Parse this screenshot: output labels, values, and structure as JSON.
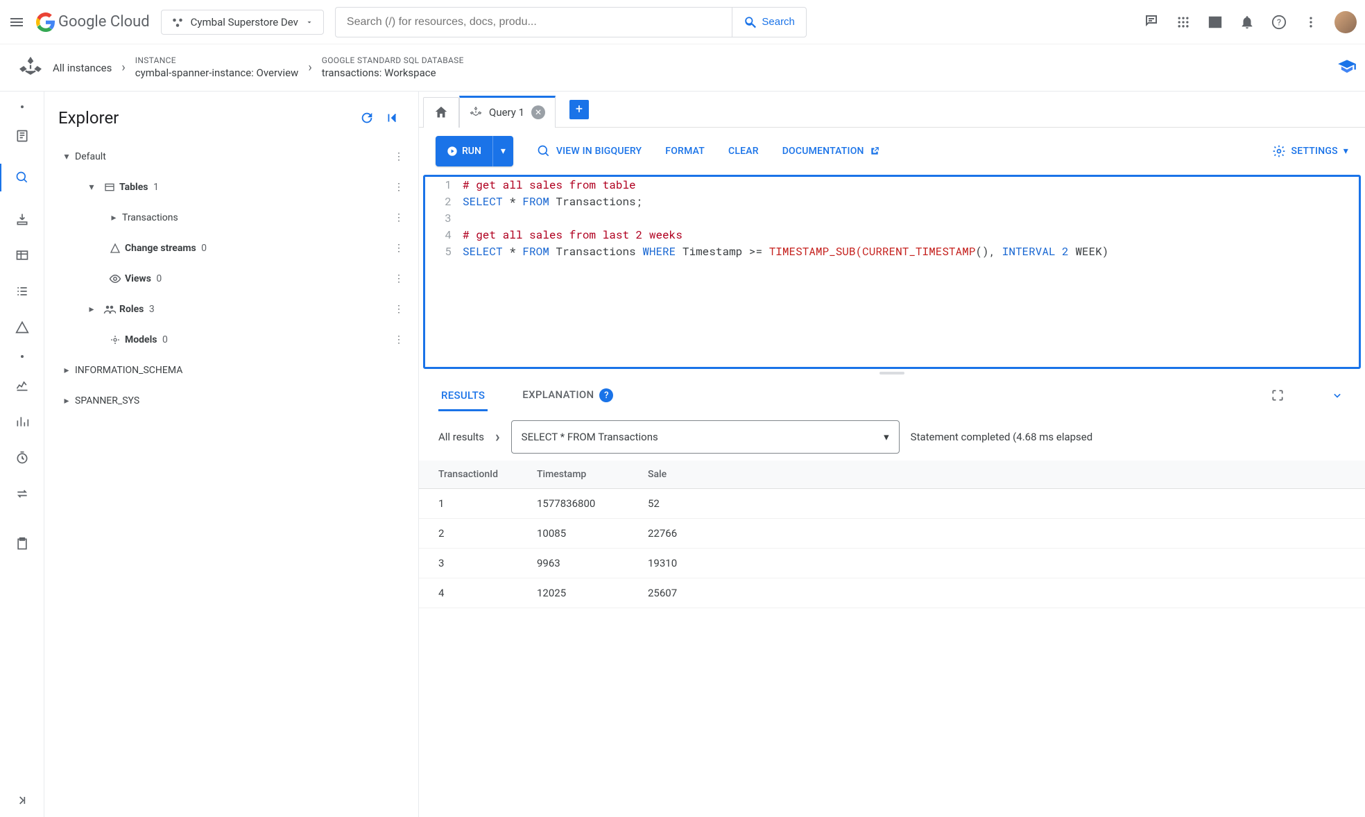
{
  "header": {
    "logo_text": "Google Cloud",
    "project": "Cymbal Superstore Dev",
    "search_placeholder": "Search (/) for resources, docs, produ...",
    "search_btn": "Search"
  },
  "breadcrumb": {
    "root": "All instances",
    "instance_label": "INSTANCE",
    "instance_value": "cymbal-spanner-instance: Overview",
    "db_label": "GOOGLE STANDARD SQL DATABASE",
    "db_value": "transactions: Workspace"
  },
  "explorer": {
    "title": "Explorer",
    "tree": {
      "default": "Default",
      "tables": "Tables",
      "tables_count": "1",
      "transactions": "Transactions",
      "change_streams": "Change streams",
      "change_streams_count": "0",
      "views": "Views",
      "views_count": "0",
      "roles": "Roles",
      "roles_count": "3",
      "models": "Models",
      "models_count": "0",
      "info_schema": "INFORMATION_SCHEMA",
      "spanner_sys": "SPANNER_SYS"
    }
  },
  "workspace": {
    "tab_label": "Query 1",
    "toolbar": {
      "run": "RUN",
      "view_bq": "VIEW IN BIGQUERY",
      "format": "FORMAT",
      "clear": "CLEAR",
      "documentation": "DOCUMENTATION",
      "settings": "SETTINGS"
    },
    "code": {
      "l1_comment": "# get all sales from table",
      "l2_kw1": "SELECT",
      "l2_mid": " * ",
      "l2_kw2": "FROM",
      "l2_tail": " Transactions;",
      "l4_comment": "# get all sales from last 2 weeks",
      "l5_kw1": "SELECT",
      "l5_mid1": " * ",
      "l5_kw2": "FROM",
      "l5_mid2": " Transactions ",
      "l5_kw3": "WHERE",
      "l5_mid3": " Timestamp >= ",
      "l5_fn": "TIMESTAMP_SUB(CURRENT_TIMESTAMP",
      "l5_paren": "(), ",
      "l5_kw4": "INTERVAL ",
      "l5_num": "2",
      "l5_tail": " WEEK)"
    },
    "results": {
      "tab_results": "RESULTS",
      "tab_explanation": "EXPLANATION",
      "all_results": "All results",
      "select_stmt": "SELECT * FROM Transactions",
      "status": "Statement completed (4.68 ms elapsed",
      "columns": [
        "TransactionId",
        "Timestamp",
        "Sale"
      ],
      "rows": [
        [
          "1",
          "1577836800",
          "52"
        ],
        [
          "2",
          "10085",
          "22766"
        ],
        [
          "3",
          "9963",
          "19310"
        ],
        [
          "4",
          "12025",
          "25607"
        ]
      ]
    }
  }
}
